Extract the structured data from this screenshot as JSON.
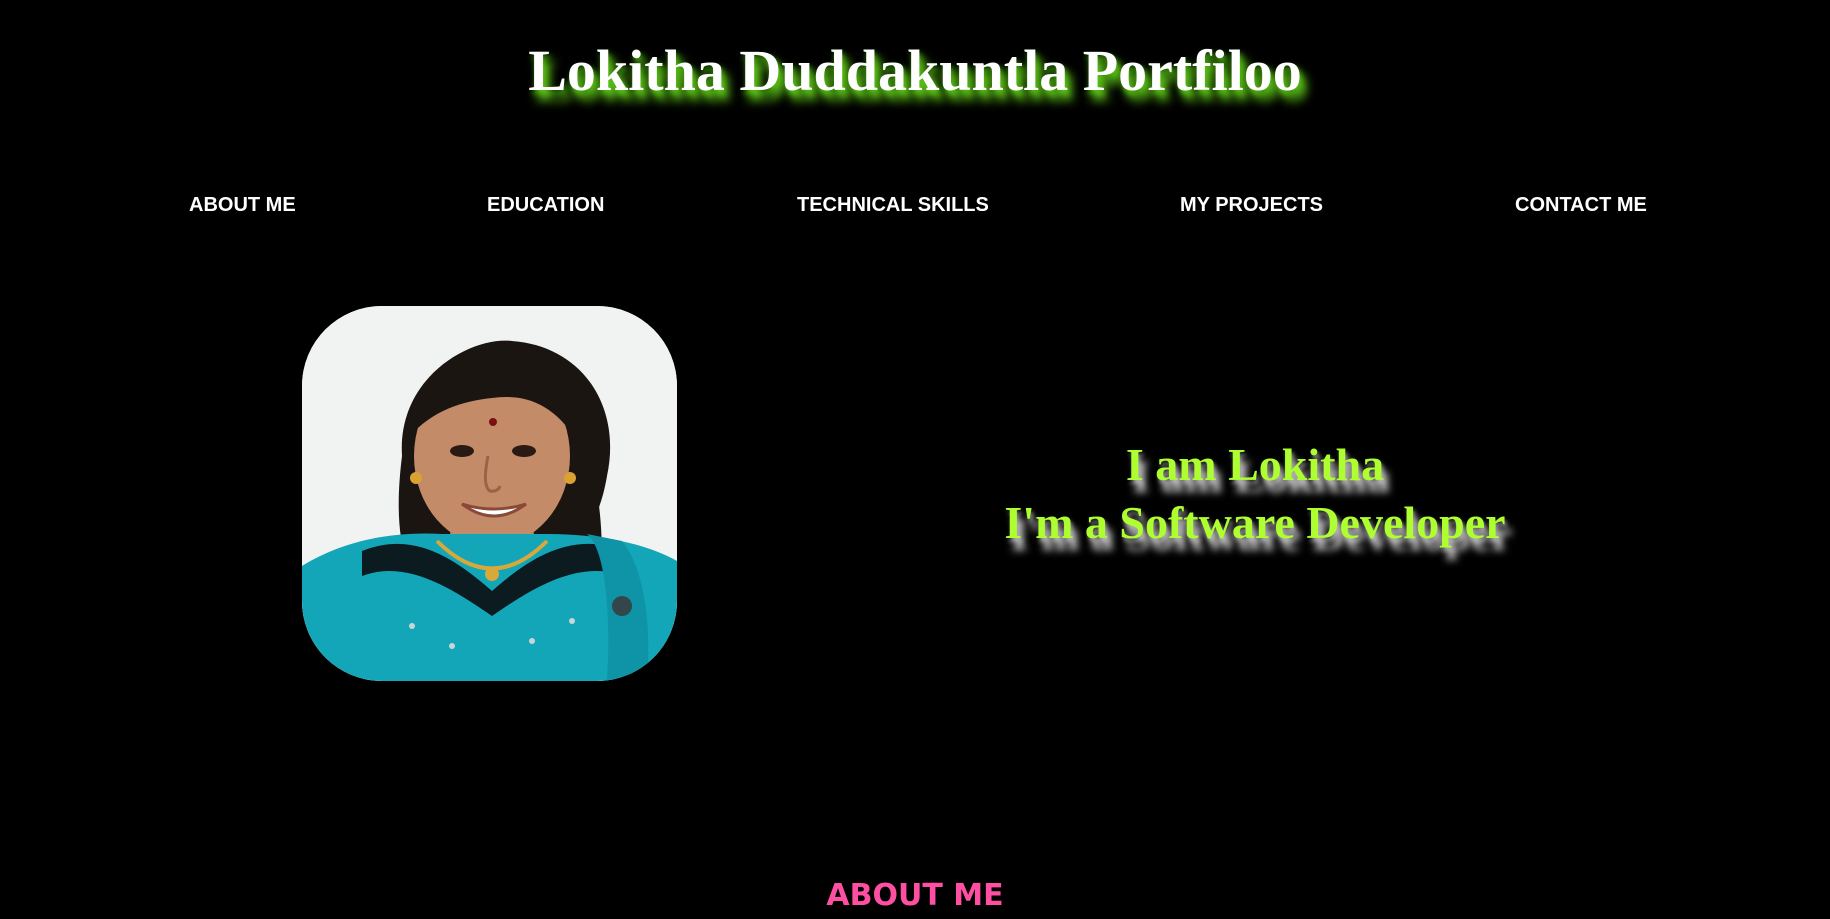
{
  "header": {
    "title": "Lokitha Duddakuntla Portfiloo"
  },
  "nav": {
    "items": [
      {
        "label": "ABOUT ME"
      },
      {
        "label": "EDUCATION"
      },
      {
        "label": "TECHNICAL SKILLS"
      },
      {
        "label": "MY PROJECTS"
      },
      {
        "label": "CONTACT ME"
      }
    ]
  },
  "hero": {
    "photo_alt": "profile photo",
    "line1": "I am Lokitha",
    "line2": "I'm a Software Developer"
  },
  "sections": {
    "about_heading": "ABOUT ME"
  },
  "colors": {
    "background": "#000000",
    "title_text": "#ffffff",
    "title_glow": "#6ddc1e",
    "intro_text": "#adff2f",
    "section_heading": "#ff4fa3"
  }
}
